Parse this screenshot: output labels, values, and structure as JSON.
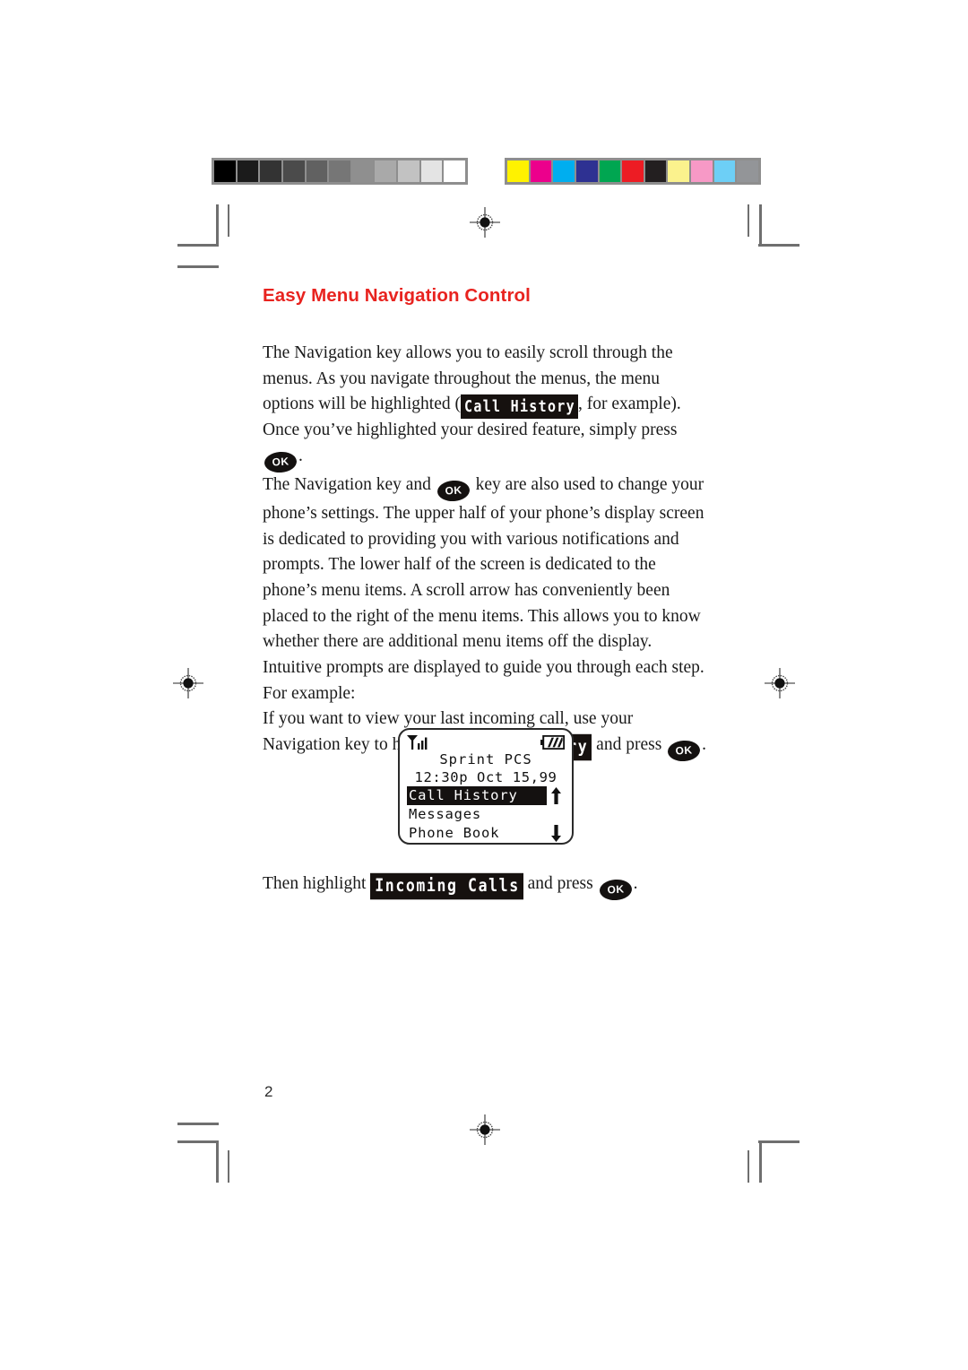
{
  "document": {
    "page_number": "2",
    "heading": "Easy Menu Navigation Control",
    "heading_color": "#e8231f"
  },
  "calibration": {
    "grayscale_label": "grayscale-step-wedge",
    "grayscale_patches": [
      "#000000",
      "#1b1b1b",
      "#333333",
      "#4b4b4b",
      "#616161",
      "#767676",
      "#8f8f8f",
      "#a9a9a9",
      "#c2c2c2",
      "#e4e4e4",
      "#ffffff"
    ],
    "color_label": "process-color-bar",
    "color_patches": [
      "#fff200",
      "#ec008c",
      "#00aeef",
      "#2e3192",
      "#00a651",
      "#ed1c24",
      "#231f20",
      "#fbf28d",
      "#f799c6",
      "#6dcff6",
      "#939598"
    ],
    "bar_frame_color": "#8e8e8e"
  },
  "body": {
    "paragraph1": {
      "seg1": "The Navigation key allows you to easily scroll through the menus. As you navigate throughout the menus, the menu options will be highlighted (",
      "badge1": "Call History",
      "seg2": ", for example). Once you’ve highlighted your desired feature, simply press ",
      "ok1": "OK",
      "seg3": "."
    },
    "paragraph2": {
      "seg1": "The Navigation key and ",
      "ok1": "OK",
      "seg2": " key are also used to change your phone’s settings. The upper half of your phone’s display screen is dedicated to providing you with various notifications and prompts. The lower half of the screen is dedicated to the phone’s menu items. A scroll arrow has conveniently been placed to the right of the menu items.  This allows you to know whether there are additional menu items off the display. Intuitive prompts are displayed to guide you through each step. For example:"
    },
    "paragraph3": {
      "seg1": "If you want to view your last incoming call, use your Navigation key to highlight ",
      "badge1": "Call History",
      "seg2": " and press ",
      "ok1": "OK",
      "seg3": "."
    },
    "paragraph4": {
      "seg1": "Then highlight ",
      "badge1": "Incoming Calls",
      "seg2": " and press ",
      "ok1": "OK",
      "seg3": "."
    }
  },
  "phone_display": {
    "signal_icon": "signal-strength-icon",
    "battery_icon": "battery-icon",
    "carrier": "Sprint PCS",
    "clock": "12:30p Oct 15,99",
    "menu_items": [
      {
        "label": "Call History",
        "selected": true,
        "arrow": "up"
      },
      {
        "label": "Messages",
        "selected": false,
        "arrow": "none"
      },
      {
        "label": "Phone Book",
        "selected": false,
        "arrow": "down"
      }
    ]
  }
}
